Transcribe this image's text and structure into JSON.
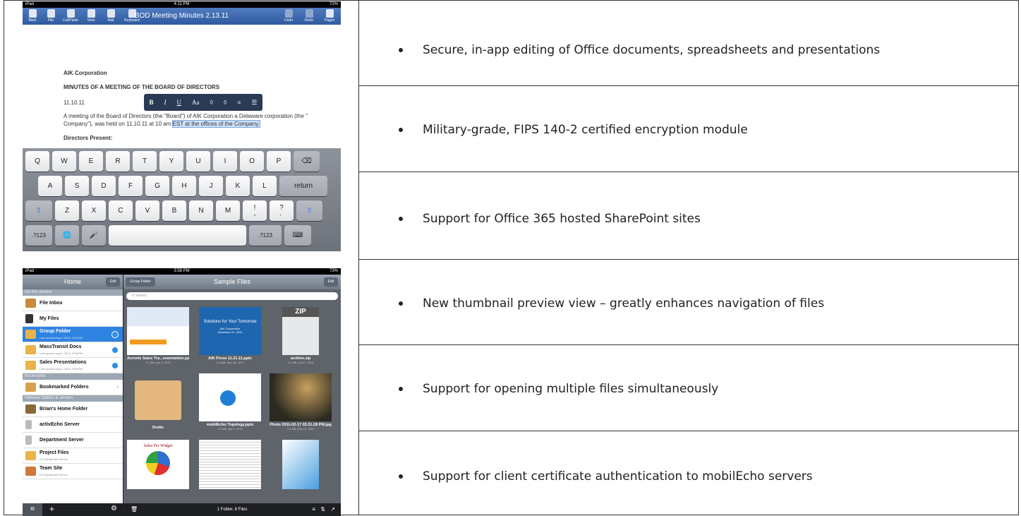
{
  "shot1": {
    "status": {
      "left": "iPad",
      "time": "4:11 PM",
      "right": "72%"
    },
    "toolbar": {
      "title": "BOD Meeting Minutes 2.13.11",
      "buttons": [
        "Back",
        "File",
        "Cut/Paste",
        "View",
        "Add",
        "Keyboard"
      ],
      "right_buttons": [
        "Undo",
        "Redo",
        "Pages"
      ]
    },
    "doc": {
      "company": "AIK Corporation",
      "heading": "MINUTES OF A MEETING OF THE BOARD OF DIRECTORS",
      "date": "11.10.11",
      "para1": "A meeting of the Board of Directors (the \"Board\") of AIK Corporation a Delaware corporation (the \"",
      "para2": "Company\"), was held on 11.10.11 at 10 am",
      "selected": "EST at the offices of the Company.",
      "directors": "Directors Present:"
    },
    "format_bar": [
      "B",
      "I",
      "U",
      "Aa",
      "◊",
      "◊",
      "≡",
      "☰"
    ],
    "keyboard": {
      "row1": [
        "Q",
        "W",
        "E",
        "R",
        "T",
        "Y",
        "U",
        "I",
        "O",
        "P",
        "⌫"
      ],
      "row2": [
        "A",
        "S",
        "D",
        "F",
        "G",
        "H",
        "J",
        "K",
        "L",
        "return"
      ],
      "row3": [
        "⇧",
        "Z",
        "X",
        "C",
        "V",
        "B",
        "N",
        "M",
        "!\n,",
        "?\n.",
        "⇧"
      ],
      "row4": [
        ".?123",
        "🌐",
        "🎤",
        "",
        ".?123",
        "⌨"
      ]
    }
  },
  "shot2": {
    "status": {
      "left": "iPad",
      "time": "3:58 PM",
      "right": "73%"
    },
    "sidebar": {
      "title": "Home",
      "edit": "Edit",
      "sections": {
        "device": "On this device",
        "bookmarks": "Bookmarks",
        "network": "Network folders & servers"
      },
      "device_items": [
        {
          "name": "File Inbox",
          "sub": ""
        },
        {
          "name": "My Files",
          "sub": ""
        },
        {
          "name": "Group Folder",
          "sub": "Last synced Aug 6, 2013, 3:58 PM"
        },
        {
          "name": "MassTransit Docs",
          "sub": "Last synced Aug 6, 2013, 3:58 PM"
        },
        {
          "name": "Sales Presentations",
          "sub": "Last synced Aug 6, 2013, 3:58 PM"
        }
      ],
      "bookmark_items": [
        {
          "name": "Bookmarked Folders"
        }
      ],
      "network_items": [
        {
          "name": "Brian's Home Folder",
          "sub": ""
        },
        {
          "name": "activEcho Server",
          "sub": ""
        },
        {
          "name": "Department Server",
          "sub": ""
        },
        {
          "name": "Project Files",
          "sub": "On Department Server"
        },
        {
          "name": "Team Site",
          "sub": "On Department Server"
        }
      ]
    },
    "main": {
      "back": "Group Folder",
      "title": "Sample Files",
      "edit": "Edit",
      "search_placeholder": "Search",
      "tiles": [
        {
          "name": "Acronis Sales Tra...resentation.pptx",
          "meta": "7.1 MB, Apr 5, 2013"
        },
        {
          "name": "AIK Preso 11.21.11.pptx",
          "meta": "2.3 MB, Nov 28, 2011"
        },
        {
          "name": "archive.zip",
          "meta": "2.1 MB, Jul 17, 2013"
        },
        {
          "name": "Drafts",
          "meta": ""
        },
        {
          "name": "mobilEcho Topology.pptx",
          "meta": "1.5 MB, Apr 9, 2013"
        },
        {
          "name": "Photo 2011-02-17 03.31.28 PM.jpg",
          "meta": "1.2 MB, Feb 17, 2011"
        }
      ],
      "preso_text": "Solutions for Your Tomorrow",
      "preso_sub": "AIK Corporation\nNovember 21, 2011",
      "chart_title": "Sales Per Widget",
      "footer": "1 Folder, 8 Files"
    }
  },
  "features": [
    "Secure, in-app editing of Office documents, spreadsheets and presentations",
    "Military-grade, FIPS 140-2 certified encryption module",
    "Support for Office 365 hosted SharePoint sites",
    "New thumbnail preview view – greatly enhances navigation of files",
    "Support for opening multiple files simultaneously",
    "Support for client certificate authentication to mobilEcho servers"
  ]
}
